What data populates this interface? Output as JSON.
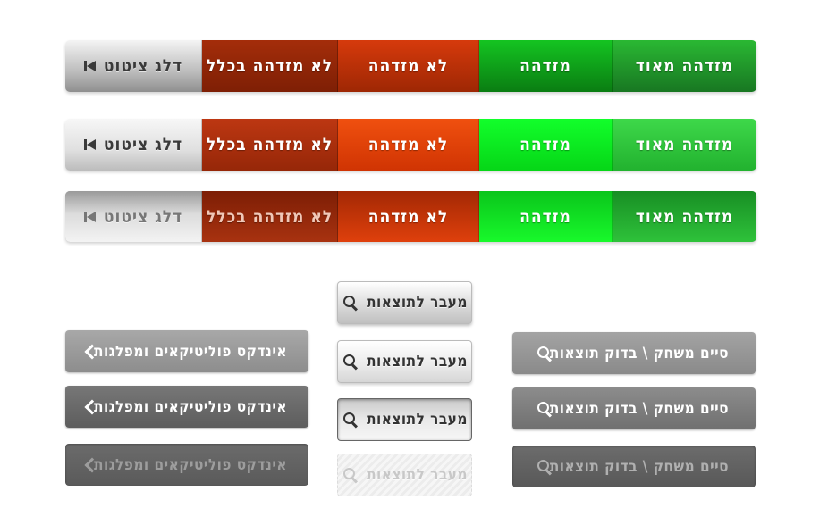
{
  "rating_bars": [
    {
      "state": "normal",
      "skip": "דלג ציטוט",
      "very_unlike": "לא מזדהה בכלל",
      "unlike": "לא מזדהה",
      "like": "מזדהה",
      "very_like": "מזדהה מאוד"
    },
    {
      "state": "hover",
      "skip": "דלג ציטוט",
      "very_unlike": "לא מזדהה בכלל",
      "unlike": "לא מזדהה",
      "like": "מזדהה",
      "very_like": "מזדהה מאוד"
    },
    {
      "state": "pressed",
      "skip": "דלג ציטוט",
      "very_unlike": "לא מזדהה בכלל",
      "unlike": "לא מזדהה",
      "like": "מזדהה",
      "very_like": "מזדהה מאוד"
    }
  ],
  "index_buttons": [
    "אינדקס פוליטיקאים ומפלגות",
    "אינדקס פוליטיקאים ומפלגות",
    "אינדקס פוליטיקאים ומפלגות"
  ],
  "results_buttons": [
    "מעבר לתוצאות",
    "מעבר לתוצאות",
    "מעבר לתוצאות",
    "מעבר לתוצאות"
  ],
  "end_buttons": [
    "סיים משחק \\ בדוק תוצאות",
    "סיים משחק \\ בדוק תוצאות",
    "סיים משחק \\ בדוק תוצאות"
  ],
  "icons": {
    "skip": "skip-back-icon",
    "chevron": "chevron-left-icon",
    "search": "search-icon"
  },
  "colors": {
    "green": "#14c421",
    "dark_green": "#187722",
    "red": "#d63a0c",
    "dark_red": "#7e1f05",
    "gray": "#8d8d8d"
  }
}
